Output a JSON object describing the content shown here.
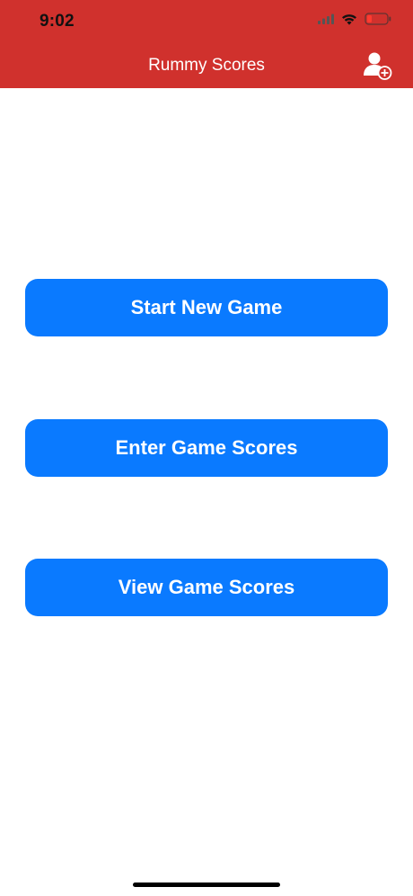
{
  "status_bar": {
    "time": "9:02",
    "icons": [
      "cellular-icon",
      "wifi-icon",
      "battery-icon"
    ],
    "battery_color": "#d0312d"
  },
  "nav": {
    "title": "Rummy Scores",
    "add_user_icon": "add-user-icon"
  },
  "actions": {
    "start_new_game": "Start New Game",
    "enter_game_scores": "Enter Game Scores",
    "view_game_scores": "View Game Scores"
  },
  "colors": {
    "header": "#d0312d",
    "button": "#0a7aff",
    "button_text": "#ffffff"
  }
}
